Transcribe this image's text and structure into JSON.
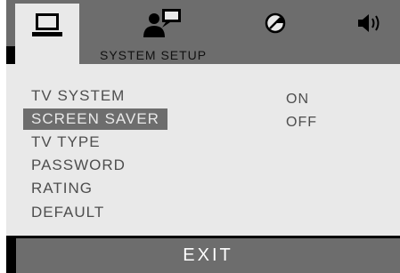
{
  "tabs": [
    {
      "icon": "monitor-icon",
      "active": true
    },
    {
      "icon": "user-chat-icon",
      "active": false
    },
    {
      "icon": "circle-slash-icon",
      "active": false
    },
    {
      "icon": "speaker-icon",
      "active": false
    }
  ],
  "header": {
    "title": "SYSTEM SETUP"
  },
  "menu": {
    "items": [
      {
        "label": "TV SYSTEM"
      },
      {
        "label": "SCREEN SAVER"
      },
      {
        "label": "TV TYPE"
      },
      {
        "label": "PASSWORD"
      },
      {
        "label": "RATING"
      },
      {
        "label": "DEFAULT"
      }
    ],
    "selected_label": "SCREEN SAVER"
  },
  "options": {
    "items": [
      {
        "label": "ON"
      },
      {
        "label": "OFF"
      }
    ]
  },
  "exit_label": "EXIT",
  "colors": {
    "panel": "#e9e9e9",
    "bar": "#6d6d6d",
    "border": "#000000",
    "text": "#4e4e4e"
  }
}
